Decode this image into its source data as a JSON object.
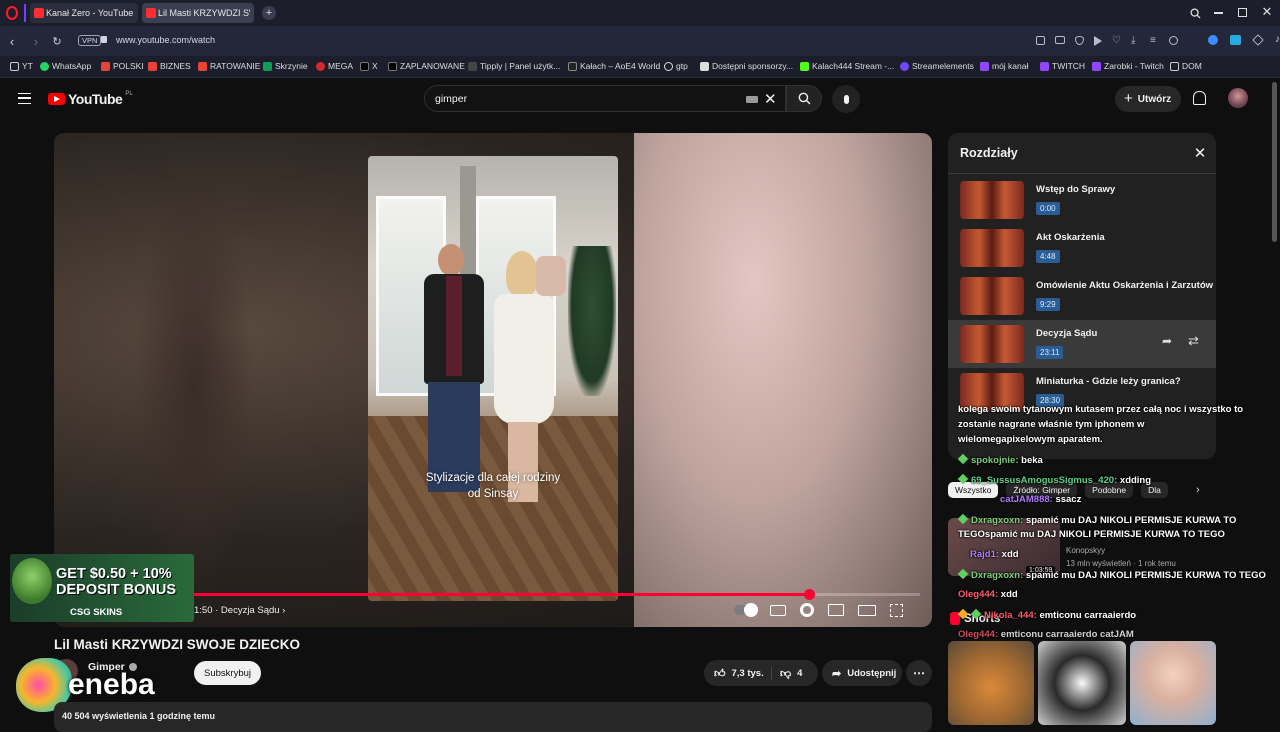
{
  "tabs": [
    {
      "label": "Kanał Zero - YouTube",
      "active": false
    },
    {
      "label": "Lil Masti KRZYWDZI SWO...",
      "active": true
    }
  ],
  "address": {
    "url": "www.youtube.com/watch",
    "vpn": "VPN"
  },
  "bookmarks": [
    "YT",
    "WhatsApp",
    "POLSKI",
    "BIZNES",
    "RATOWANIE",
    "Skrzynie",
    "MEGA",
    "X",
    "ZAPLANOWANE",
    "Tipply | Panel użytk...",
    "Kałach – AoE4 World",
    "gtp",
    "Dostępni sponsorzy...",
    "Kalach444 Stream -...",
    "Streamelements",
    "mój kanał",
    "TWITCH",
    "Zarobki - Twitch",
    "DOM"
  ],
  "yt": {
    "logo": "YouTube",
    "region": "PL",
    "search_value": "gimper",
    "create_label": "Utwórz"
  },
  "video": {
    "overlay_text_line1": "Stylizacje dla całej rodziny",
    "overlay_text_line2": "od Sinsay",
    "time_chapter": "1:50 · Decyzja Sądu",
    "progress_fraction": 0.87,
    "title": "Lil Masti KRZYWDZI SWOJE DZIECKO",
    "channel": "Gimper",
    "subscribe_label": "Subskrybuj",
    "likes": "7,3 tys.",
    "dislikes": "4",
    "share_label": "Udostępnij",
    "views_line": "40 504 wyświetlenia  1 godzinę temu"
  },
  "ad": {
    "line1": "GET $0.50 + 10%",
    "line2": "DEPOSIT BONUS",
    "brand": "CSG SKINS"
  },
  "eneba": "eneba",
  "chapters": {
    "heading": "Rozdziały",
    "items": [
      {
        "title": "Wstęp do Sprawy",
        "time": "0:00"
      },
      {
        "title": "Akt Oskarżenia",
        "time": "4:48"
      },
      {
        "title": "Omówienie Aktu Oskarżenia i Zarzutów",
        "time": "9:29"
      },
      {
        "title": "Decyzja Sądu",
        "time": "23:11"
      },
      {
        "title": "Miniaturka - Gdzie leży granica?",
        "time": "28:30"
      }
    ]
  },
  "chips": [
    "Wszystko",
    "Źródło: Gimper",
    "Podobne",
    "Dla"
  ],
  "related": {
    "channel": "Konopskyy",
    "stats": "13 mln wyświetleń · 1 rok temu",
    "duration": "1:03:59",
    "shorts": "Shorts"
  },
  "chat": {
    "message1_line1": "kolega swoim tytanowym kutasem przez całą noc i wszystko to",
    "message1_line2": "zostanie nagrane właśnie tym iphonem w",
    "message1_line3": "wielomegapixelowym aparatem.",
    "lines": [
      {
        "user": "spokojnie:",
        "text": " beka"
      },
      {
        "user": "69_SussusAmogusSigmus_420:",
        "text": " xdding"
      },
      {
        "user": "catJAM888:",
        "text": " ssacz"
      },
      {
        "user": "Dxragxoxn:",
        "text": " spamić mu DAJ NIKOLI PERMISJE KURWA TO"
      },
      {
        "user": "",
        "text": "TEGOspamić mu DAJ NIKOLI PERMISJE KURWA TO TEGO"
      },
      {
        "user": "Rajd1:",
        "text": " xdd"
      },
      {
        "user": "Dxragxoxn:",
        "text": " spamić mu DAJ NIKOLI PERMISJE KURWA TO TEGO"
      },
      {
        "user": "Oleg444:",
        "text": " xdd"
      },
      {
        "user": "Nikola_444:",
        "text": " emticonu carraaierdo"
      },
      {
        "user": "Oleg444:",
        "text": " emticonu carraaierdo catJAM"
      }
    ]
  }
}
